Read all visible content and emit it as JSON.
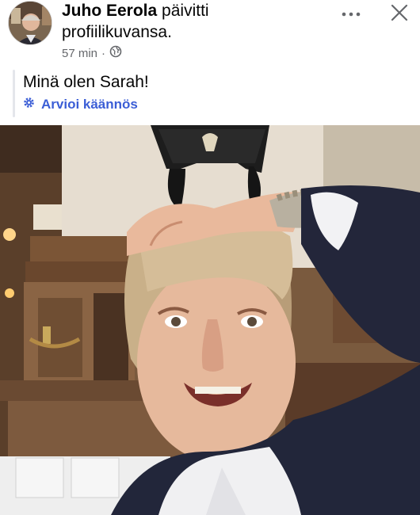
{
  "post": {
    "author": "Juho Eerola",
    "action_line1": "päivitti",
    "action_line2": "profiilikuvansa.",
    "time": "57 min",
    "separator": "·",
    "text": "Minä olen Sarah!",
    "translate_label": "Arvioi käännös"
  },
  "icons": {
    "more": "more-horizontal-icon",
    "close": "close-icon",
    "audience": "globe-icon",
    "translate": "gear-icon"
  },
  "colors": {
    "link_blue": "#3b5ed6",
    "meta_gray": "#65676b"
  }
}
